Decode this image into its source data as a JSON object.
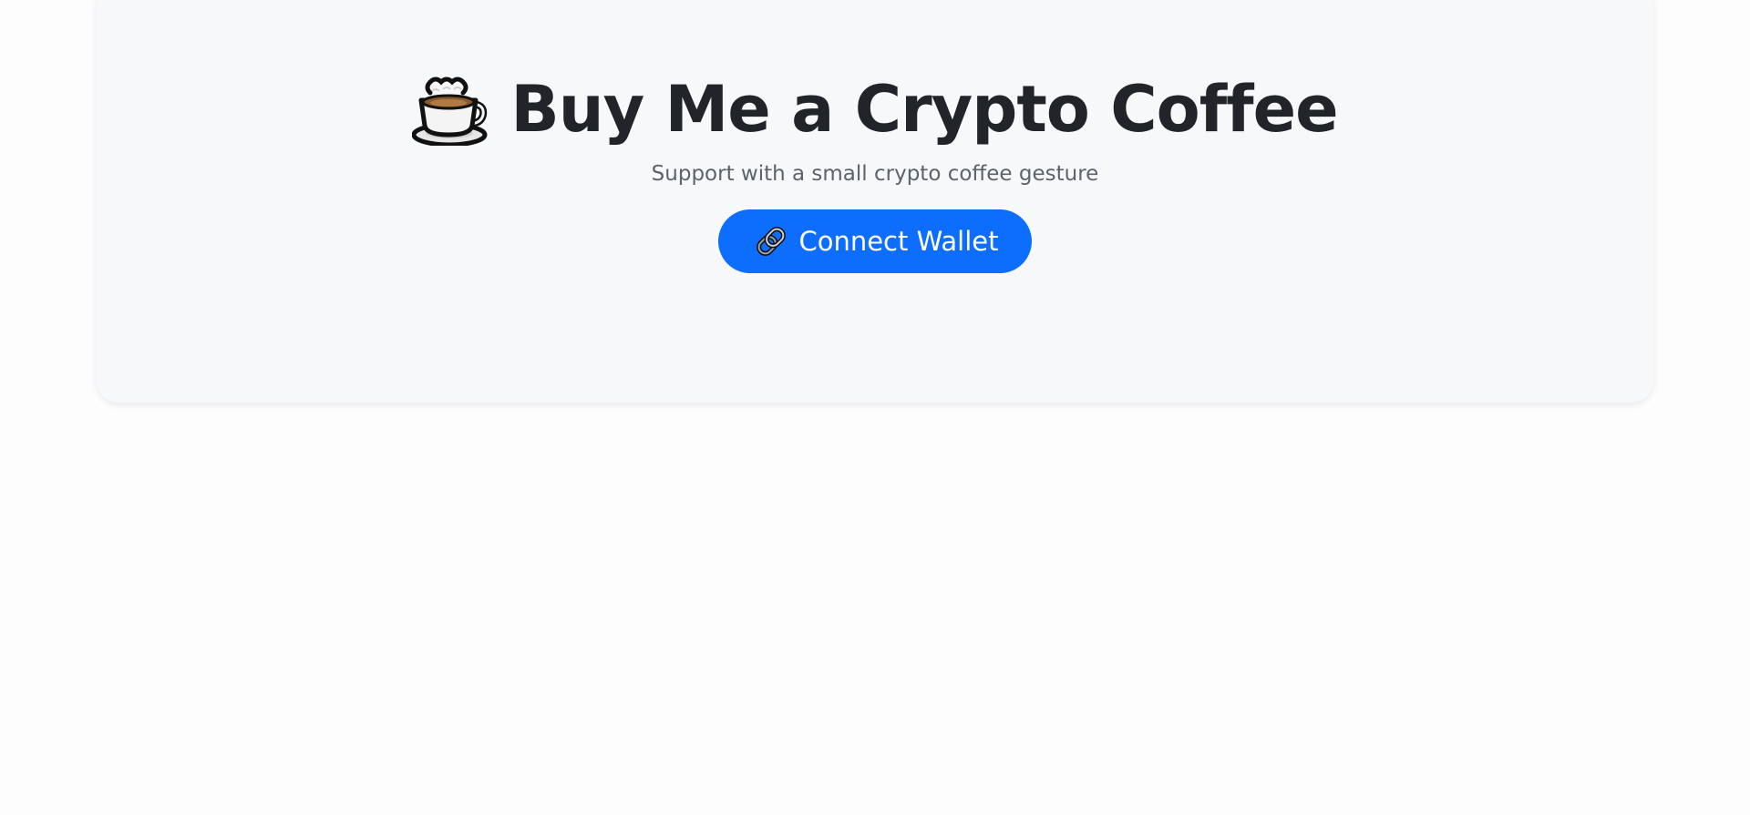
{
  "hero": {
    "title": "Buy Me a Crypto Coffee",
    "title_icon": "hot-beverage-icon",
    "subtitle": "Support with a small crypto coffee gesture",
    "connect_button": {
      "label": "Connect Wallet",
      "icon": "link-icon"
    }
  },
  "colors": {
    "card_background": "#f7f8fa",
    "title_text": "#212529",
    "subtitle_text": "#5c636a",
    "button_background": "#0d6efd",
    "button_text": "#ffffff",
    "page_background": "#fdfdfe"
  }
}
